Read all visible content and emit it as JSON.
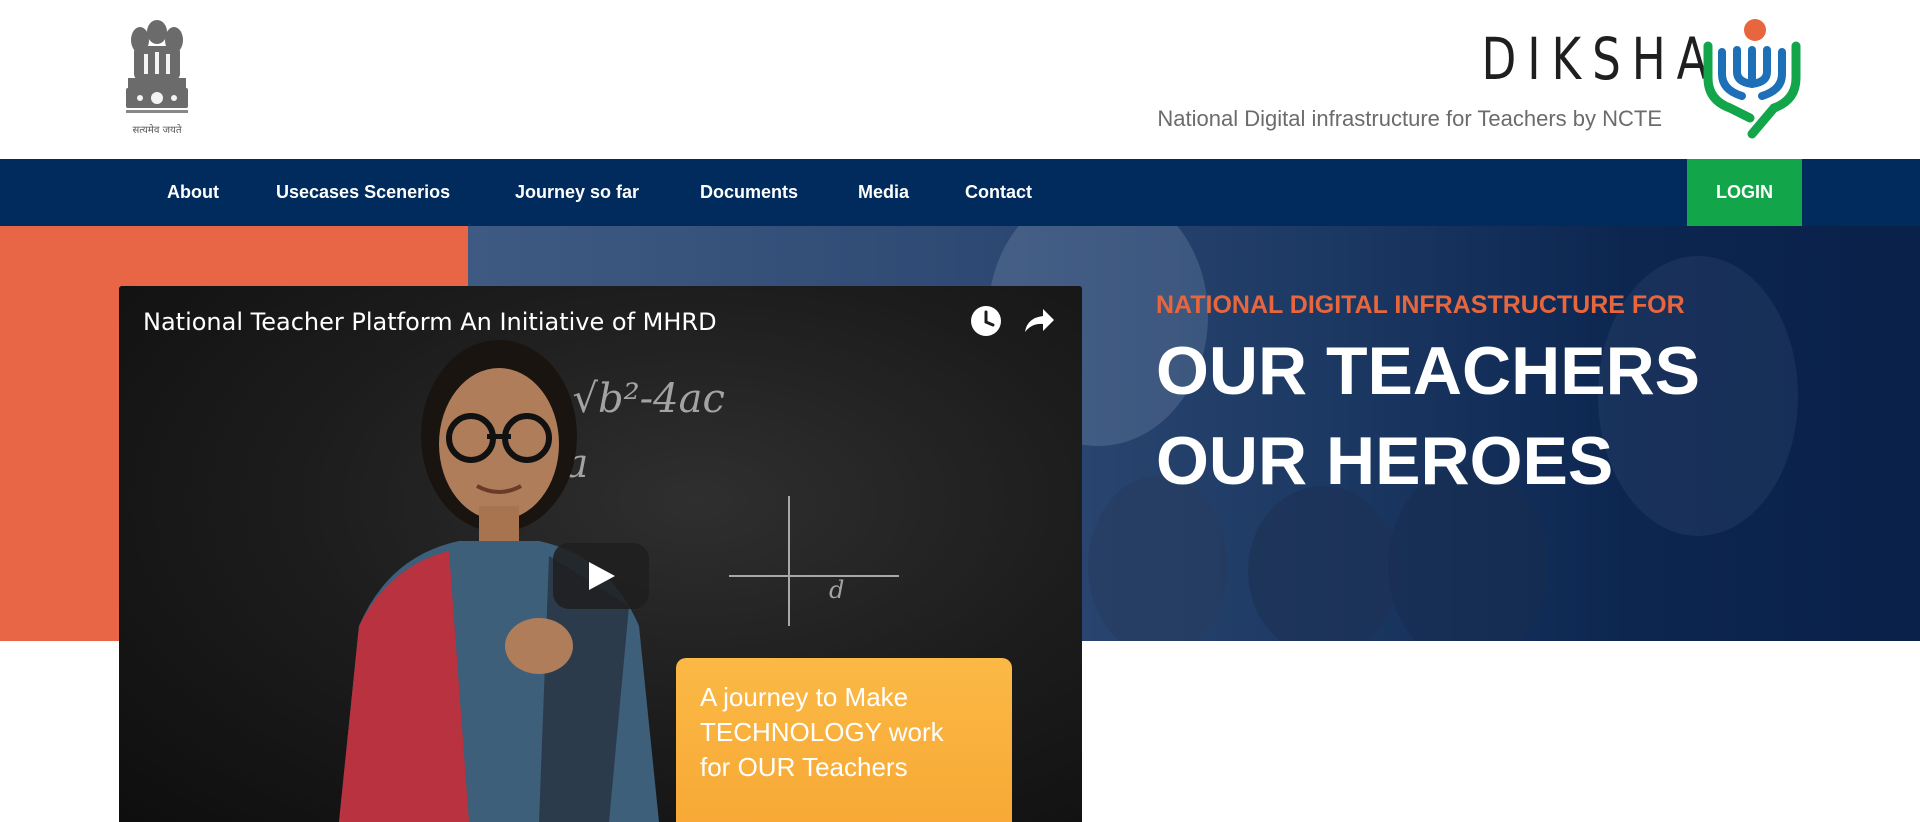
{
  "header": {
    "emblem_text": "सत्यमेव जयते",
    "brand_name": "DIKSHA",
    "tagline": "National Digital infrastructure for Teachers by NCTE"
  },
  "nav": {
    "items": [
      {
        "label": "About"
      },
      {
        "label": "Usecases Scenerios"
      },
      {
        "label": "Journey so far"
      },
      {
        "label": "Documents"
      },
      {
        "label": "Media"
      },
      {
        "label": "Contact"
      }
    ],
    "login_label": "LOGIN"
  },
  "hero": {
    "eyebrow": "NATIONAL DIGITAL INFRASTRUCTURE FOR",
    "title_line1": "OUR TEACHERS",
    "title_line2": "OUR HEROES"
  },
  "video": {
    "title": "National Teacher Platform An Initiative of MHRD",
    "promo_lines": [
      "A journey to Make",
      "TECHNOLOGY work",
      "for OUR Teachers"
    ],
    "chalk_formula": "±√b²-4ac",
    "chalk_denominator": "2a",
    "chalk_axis_label": "d"
  },
  "colors": {
    "navbar": "#002b5c",
    "login": "#13a54a",
    "hero_accent": "#e86646",
    "promo": "#f7a532"
  },
  "icons": [
    "national-emblem-icon",
    "diksha-logo-icon",
    "clock-icon",
    "share-icon",
    "play-icon"
  ]
}
